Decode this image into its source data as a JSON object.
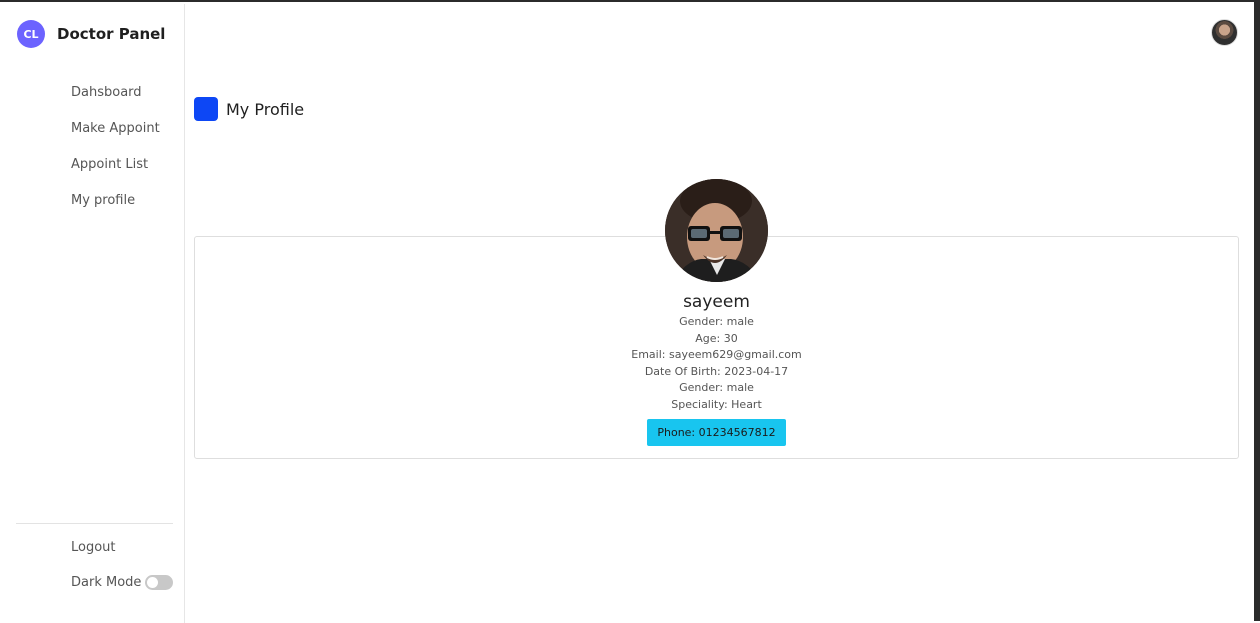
{
  "brand": {
    "logo_text": "CL",
    "title": "Doctor Panel"
  },
  "sidebar": {
    "items": [
      {
        "label": "Dahsboard"
      },
      {
        "label": "Make Appoint"
      },
      {
        "label": "Appoint List"
      },
      {
        "label": "My profile"
      }
    ],
    "logout_label": "Logout",
    "dark_mode_label": "Dark Mode",
    "dark_mode_enabled": false
  },
  "header": {
    "avatar_icon": "user-avatar"
  },
  "page": {
    "title": "My Profile"
  },
  "profile": {
    "name": "sayeem",
    "gender_line": "Gender: male",
    "age_line": "Age: 30",
    "email_line": "Email: sayeem629@gmail.com",
    "dob_line": "Date Of Birth: 2023-04-17",
    "gender_line_2": "Gender: male",
    "speciality_line": "Speciality: Heart",
    "phone_label": "Phone: 01234567812"
  },
  "colors": {
    "brand_logo": "#6c63ff",
    "title_icon": "#0d47f5",
    "phone_badge": "#18c5ef"
  }
}
